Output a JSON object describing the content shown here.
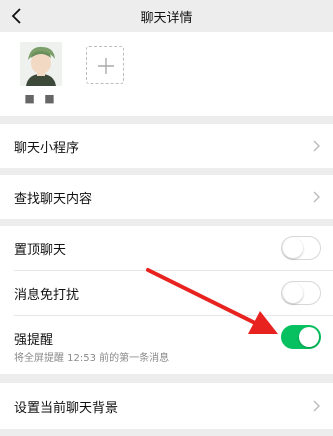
{
  "header": {
    "title": "聊天详情"
  },
  "members": {
    "name": "■ ■",
    "add_symbol": "+"
  },
  "menu": {
    "mini_program": "聊天小程序",
    "search_history": "查找聊天内容",
    "pin_chat": "置顶聊天",
    "mute": "消息免打扰",
    "strong_reminder": "强提醒",
    "strong_reminder_desc": "将全屏提醒 12:53 前的第一条消息",
    "set_background": "设置当前聊天背景"
  },
  "toggles": {
    "pin_chat": false,
    "mute": false,
    "strong_reminder": true
  },
  "colors": {
    "accent": "#07c160",
    "annotation_arrow": "#e8231f",
    "background": "#ededed"
  }
}
